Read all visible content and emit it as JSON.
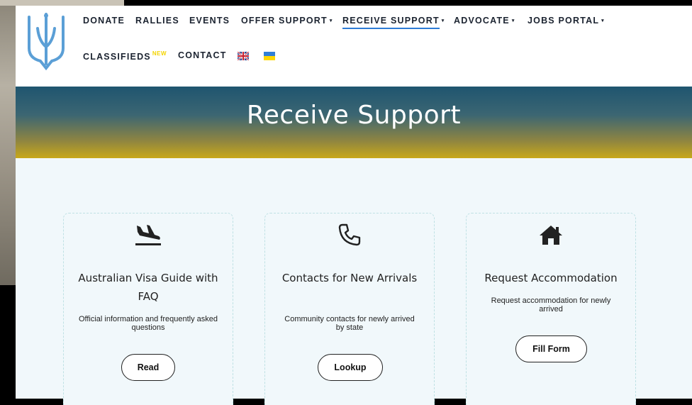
{
  "nav": {
    "donate": "DONATE",
    "rallies": "RALLIES",
    "events": "EVENTS",
    "offer_support": "OFFER SUPPORT",
    "receive_support": "RECEIVE SUPPORT",
    "advocate": "ADVOCATE",
    "jobs_portal": "JOBS PORTAL",
    "classifieds": "CLASSIFIEDS",
    "classifieds_badge": "NEW",
    "contact": "CONTACT",
    "caret": "▾"
  },
  "hero": {
    "title": "Receive Support"
  },
  "cards": [
    {
      "icon": "plane-landing-icon",
      "title": "Australian Visa Guide with FAQ",
      "description": "Official information and frequently asked questions",
      "button": "Read"
    },
    {
      "icon": "phone-icon",
      "title": "Contacts for New Arrivals",
      "description": "Community contacts for newly arrived by state",
      "button": "Lookup"
    },
    {
      "icon": "home-icon",
      "title": "Request Accommodation",
      "description": "Request accommodation for newly arrived",
      "button": "Fill Form"
    }
  ],
  "colors": {
    "accent": "#2d7bd6",
    "badge": "#f4d400",
    "logo_blue": "#5b9fd6",
    "flag_blue": "#2f7fd8",
    "flag_yellow": "#ffd700"
  }
}
